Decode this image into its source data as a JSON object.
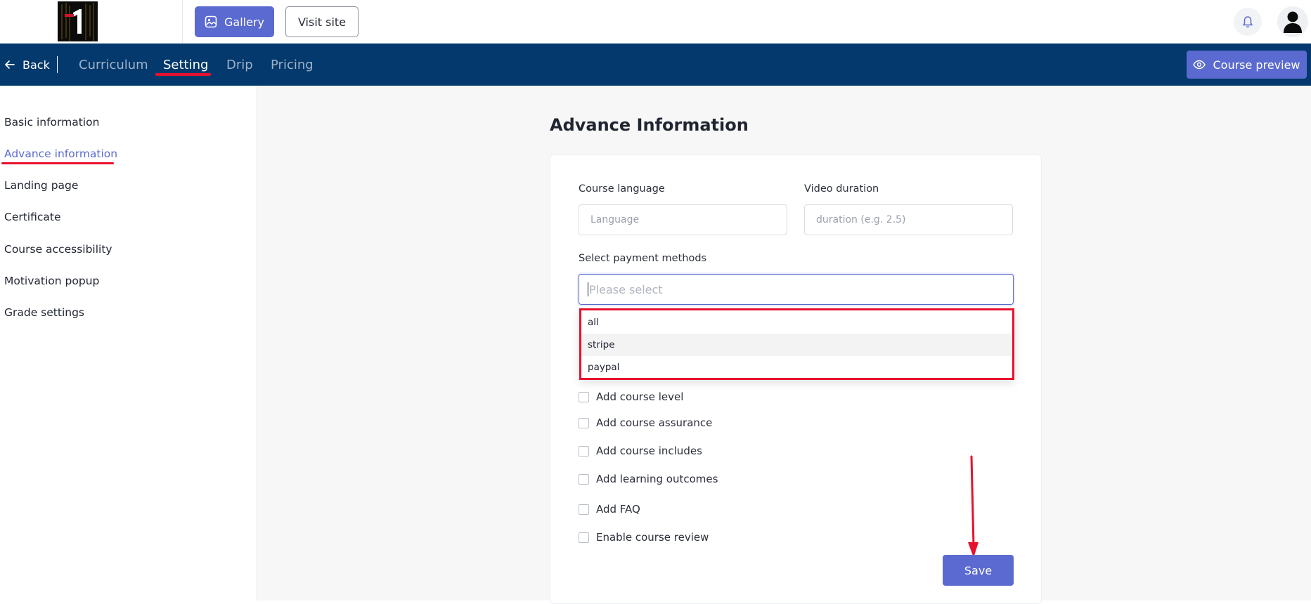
{
  "header": {
    "logo_text": "1",
    "gallery_label": "Gallery",
    "visit_site_label": "Visit site",
    "icons": {
      "gallery": "gallery-icon",
      "bell": "bell-icon",
      "avatar": "user-avatar-icon"
    }
  },
  "navbar": {
    "back_label": "Back",
    "tabs": [
      {
        "label": "Curriculum",
        "active": false
      },
      {
        "label": "Setting",
        "active": true
      },
      {
        "label": "Drip",
        "active": false
      },
      {
        "label": "Pricing",
        "active": false
      }
    ],
    "preview_label": "Course preview"
  },
  "sidebar": {
    "items": [
      {
        "label": "Basic information",
        "active": false
      },
      {
        "label": "Advance information",
        "active": true
      },
      {
        "label": "Landing page",
        "active": false
      },
      {
        "label": "Certificate",
        "active": false
      },
      {
        "label": "Course accessibility",
        "active": false
      },
      {
        "label": "Motivation popup",
        "active": false
      },
      {
        "label": "Grade settings",
        "active": false
      }
    ]
  },
  "main": {
    "title": "Advance Information",
    "course_language": {
      "label": "Course language",
      "placeholder": "Language",
      "value": ""
    },
    "video_duration": {
      "label": "Video duration",
      "placeholder": "duration (e.g. 2.5)",
      "value": ""
    },
    "payment_methods": {
      "label": "Select payment methods",
      "placeholder": "Please select",
      "options": [
        "all",
        "stripe",
        "paypal"
      ],
      "hovered_option": "stripe"
    },
    "checkboxes": [
      {
        "label": "Add course level",
        "checked": false
      },
      {
        "label": "Add course assurance",
        "checked": false
      },
      {
        "label": "Add course includes",
        "checked": false
      },
      {
        "label": "Add learning outcomes",
        "checked": false
      },
      {
        "label": "Add FAQ",
        "checked": false
      },
      {
        "label": "Enable course review",
        "checked": false
      }
    ],
    "save_label": "Save"
  },
  "colors": {
    "navy": "#03396c",
    "accent": "#5b6ad0",
    "annotation_red": "#e8112d"
  }
}
